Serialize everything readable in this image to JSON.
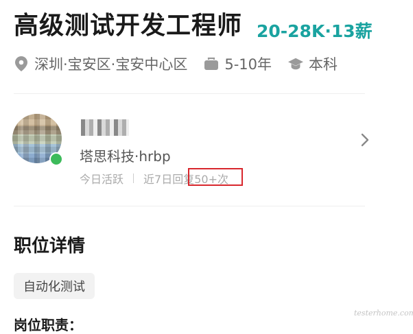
{
  "job": {
    "title": "高级测试开发工程师",
    "salary": "20-28K·13薪"
  },
  "meta": {
    "location": "深圳·宝安区·宝安中心区",
    "experience": "5-10年",
    "education": "本科",
    "icons": [
      "location-pin-icon",
      "briefcase-icon",
      "graduation-cap-icon"
    ]
  },
  "recruiter": {
    "company_role": "塔思科技·hrbp",
    "active_status": "今日活跃",
    "reply_prefix": "近7日回",
    "reply_highlight": "复50+次",
    "online_color": "#3dbb5b",
    "highlight_color": "#d8262c"
  },
  "details": {
    "section_title": "职位详情",
    "tags": [
      "自动化测试"
    ],
    "next_heading": "岗位职责："
  },
  "watermark": "testerhome.com",
  "colors": {
    "salary": "#1aa3a0"
  }
}
